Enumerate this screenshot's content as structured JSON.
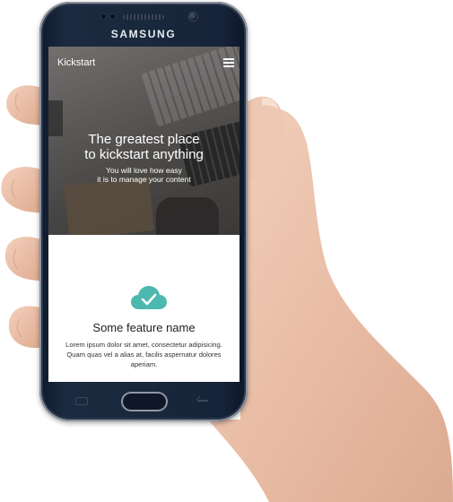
{
  "device": {
    "brand": "SAMSUNG"
  },
  "app": {
    "logo": "Kickstart",
    "menu_icon": "hamburger-menu-icon"
  },
  "hero": {
    "title_line1": "The greatest place",
    "title_line2": "to kickstart anything",
    "subtitle_line1": "You will love how easy",
    "subtitle_line2": "it is to manage your content"
  },
  "feature": {
    "icon": "cloud-check-icon",
    "icon_color": "#4db8b0",
    "title": "Some feature name",
    "body_line1": "Lorem ipsum dolor sit amet, consectetur adipisicing.",
    "body_line2": "Quam quas vel a alias at, facilis aspernatur dolores",
    "body_line3": "aperiam."
  }
}
